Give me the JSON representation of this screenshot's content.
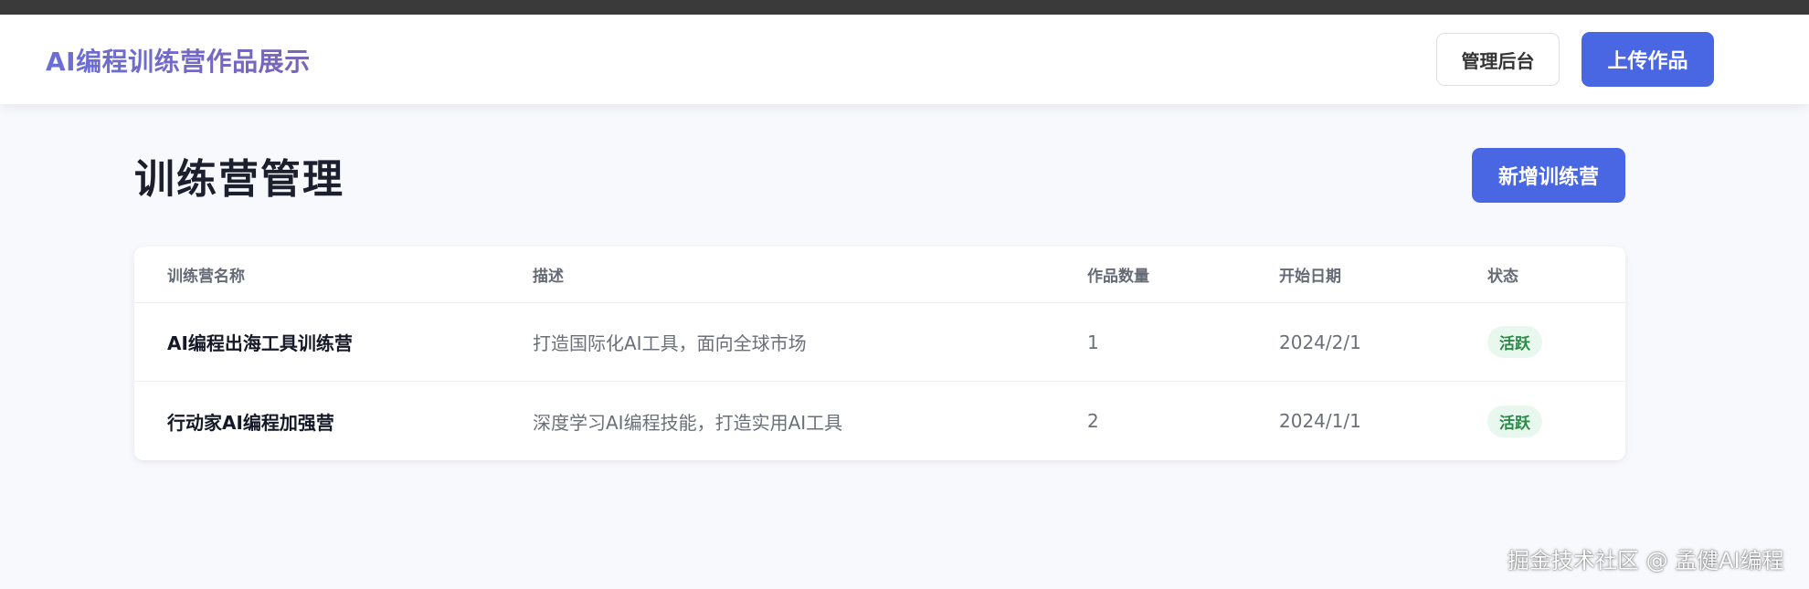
{
  "header": {
    "brand": "AI编程训练营作品展示",
    "admin_label": "管理后台",
    "upload_label": "上传作品"
  },
  "main": {
    "title": "训练营管理",
    "add_label": "新增训练营"
  },
  "table": {
    "columns": [
      "训练营名称",
      "描述",
      "作品数量",
      "开始日期",
      "状态"
    ],
    "rows": [
      {
        "name": "AI编程出海工具训练营",
        "description": "打造国际化AI工具，面向全球市场",
        "works": "1",
        "start_date": "2024/2/1",
        "status": "活跃"
      },
      {
        "name": "行动家AI编程加强营",
        "description": "深度学习AI编程技能，打造实用AI工具",
        "works": "2",
        "start_date": "2024/1/1",
        "status": "活跃"
      }
    ]
  },
  "watermark": "掘金技术社区 @ 孟健AI编程",
  "colors": {
    "primary": "#4a67e3",
    "brand_gradient_start": "#6a6fd6",
    "brand_gradient_end": "#7a64b8",
    "status_active_bg": "#e9f8ee",
    "status_active_text": "#2a8a46"
  }
}
